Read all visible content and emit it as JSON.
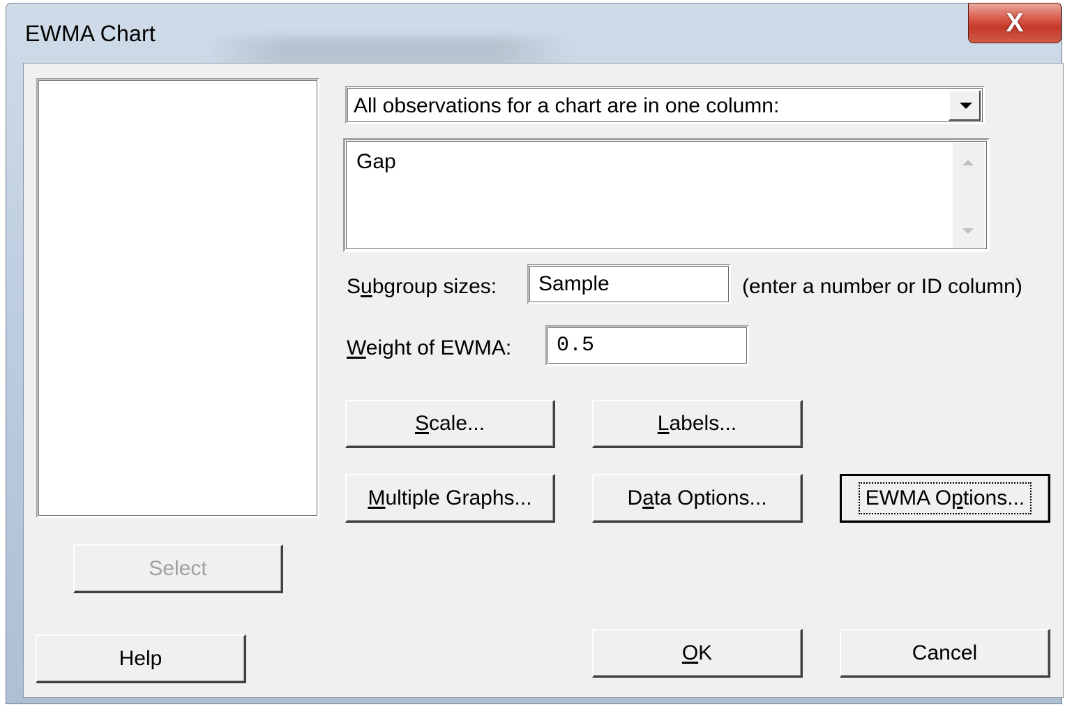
{
  "window": {
    "title": "EWMA Chart",
    "close_glyph": "X"
  },
  "data_arrangement": {
    "selected": "All observations for a chart are in one column:"
  },
  "variables_box": {
    "value": "Gap"
  },
  "subgroup": {
    "label_pre": "S",
    "label_accel": "u",
    "label_post": "bgroup sizes:",
    "value": "Sample",
    "hint": "(enter a number or ID column)"
  },
  "weight": {
    "label_accel": "W",
    "label_post": "eight of EWMA:",
    "value": "0.5"
  },
  "buttons": {
    "scale": {
      "pre": "",
      "accel": "S",
      "post": "cale..."
    },
    "labels": {
      "pre": "",
      "accel": "L",
      "post": "abels..."
    },
    "multiple_graphs": {
      "pre": "",
      "accel": "M",
      "post": "ultiple Graphs..."
    },
    "data_options": {
      "pre": "D",
      "accel": "a",
      "post": "ta Options..."
    },
    "ewma_options": {
      "pre": "EWMA O",
      "accel": "p",
      "post": "tions..."
    },
    "select": "Select",
    "help": "Help",
    "ok": {
      "pre": "",
      "accel": "O",
      "post": "K"
    },
    "cancel": "Cancel"
  }
}
